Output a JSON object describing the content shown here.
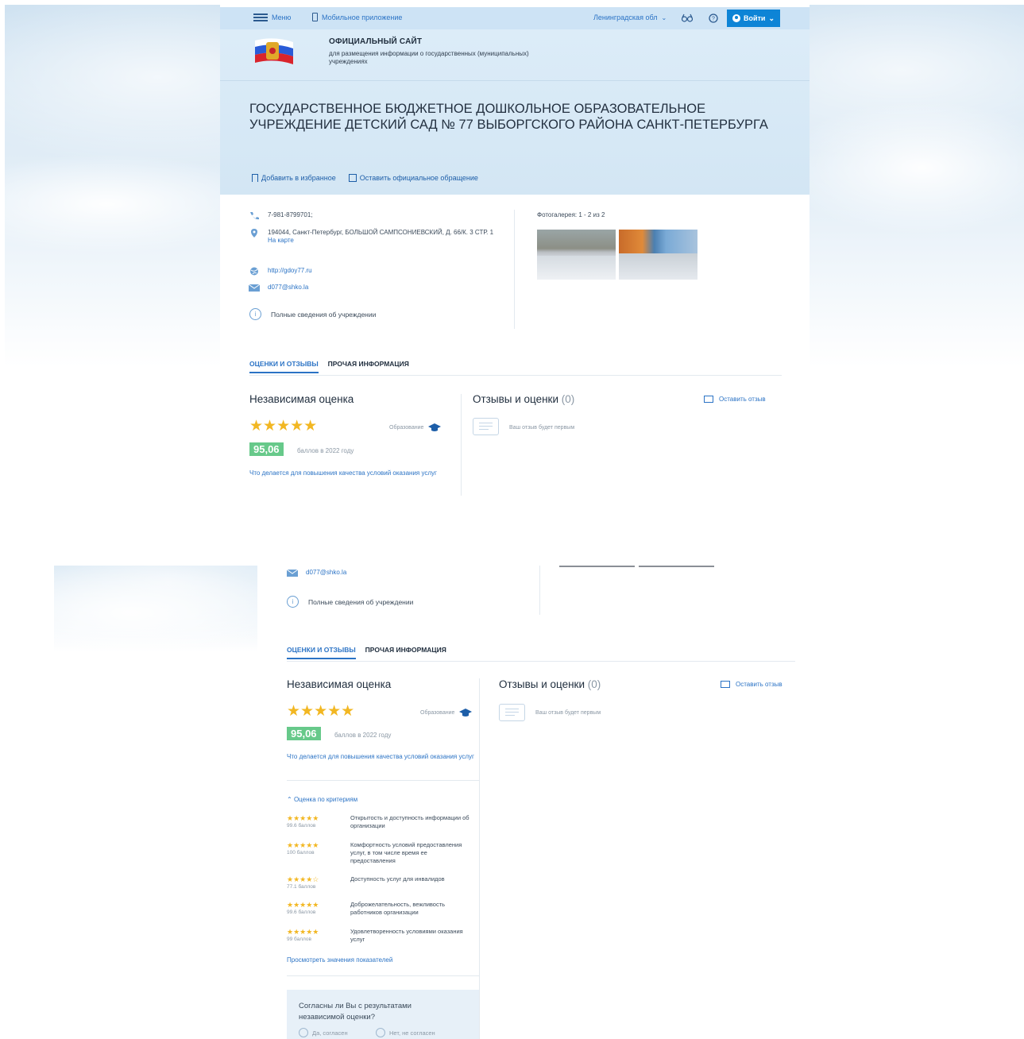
{
  "topbar": {
    "menu": "Меню",
    "mobile_app": "Мобильное приложение",
    "region": "Ленинградская обл",
    "login": "Войти"
  },
  "site": {
    "title": "ОФИЦИАЛЬНЫЙ САЙТ",
    "subtitle": "для размещения информации о государственных (муниципальных) учреждениях"
  },
  "org": {
    "title": "ГОСУДАРСТВЕННОЕ БЮДЖЕТНОЕ ДОШКОЛЬНОЕ ОБРАЗОВАТЕЛЬНОЕ УЧРЕЖДЕНИЕ ДЕТСКИЙ САД № 77 ВЫБОРГСКОГО РАЙОНА САНКТ-ПЕТЕРБУРГА"
  },
  "actions": {
    "favorite": "Добавить в избранное",
    "appeal": "Оставить официальное обращение"
  },
  "contacts": {
    "phone": "7-981-8799701;",
    "address": "194044, Санкт-Петербург, БОЛЬШОЙ САМПСОНИЕВСКИЙ, Д. 66/К. 3 СТР. 1",
    "map_link": "На карте",
    "website": "http://gdoy77.ru",
    "email": "d077@shko.la",
    "full_info": "Полные сведения об учреждении"
  },
  "gallery": {
    "title": "Фотогалерея: 1 - 2 из 2"
  },
  "tabs": {
    "reviews": "ОЦЕНКИ И ОТЗЫВЫ",
    "other": "ПРОЧАЯ ИНФОРМАЦИЯ"
  },
  "score": {
    "heading": "Независимая оценка",
    "category": "Образование",
    "value": "95,06",
    "caption": "баллов в 2022 году",
    "stars": "★★★★★",
    "improve_link": "Что делается для повышения качества условий оказания услуг"
  },
  "reviews": {
    "heading": "Отзывы и оценки",
    "count": "(0)",
    "leave": "Оставить отзыв",
    "first": "Ваш отзыв будет первым"
  },
  "criteria": {
    "toggle": "Оценка по критериям",
    "items": [
      {
        "stars": "★★★★★",
        "points": "99.6 баллов",
        "label": "Открытость и доступность информации об организации"
      },
      {
        "stars": "★★★★★",
        "points": "100 баллов",
        "label": "Комфортность условий предоставления услуг, в том числе время ее предоставления"
      },
      {
        "stars": "★★★★☆",
        "points": "77.1 баллов",
        "label": "Доступность услуг для инвалидов"
      },
      {
        "stars": "★★★★★",
        "points": "99.6 баллов",
        "label": "Доброжелательность, вежливость работников организации"
      },
      {
        "stars": "★★★★★",
        "points": "99 баллов",
        "label": "Удовлетворенность условиями оказания услуг"
      }
    ],
    "view_link": "Просмотреть значения показателей"
  },
  "agree": {
    "question": "Согласны ли Вы с результатами независимой оценки?",
    "yes": "Да, согласен",
    "no": "Нет, не согласен"
  },
  "colors": {
    "accent": "#2b73c5",
    "login_button": "#0d84d6",
    "score_badge": "#67c98a",
    "stars": "#f2b722"
  }
}
